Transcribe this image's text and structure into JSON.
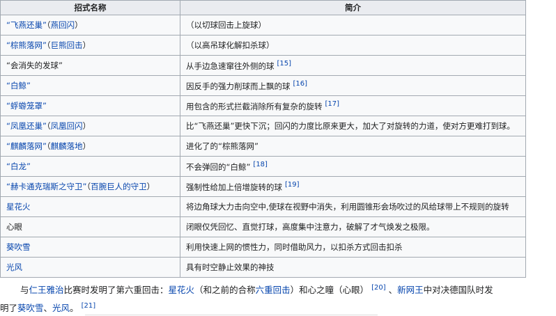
{
  "table": {
    "headers": [
      "招式名称",
      "简介"
    ],
    "rows": [
      {
        "name_link": "“飞燕还巢”",
        "name_tail": "（",
        "alias": "燕回闪",
        "alias_tail": "）",
        "desc": "（以切球回击上旋球）",
        "ref": ""
      },
      {
        "name_link": "“棕熊落网”",
        "name_tail": "（",
        "alias": "巨熊回击",
        "alias_tail": "）",
        "desc": "（以高吊球化解扣杀球）",
        "ref": ""
      },
      {
        "name_plain": "“会消失的发球”",
        "desc": "从手边急速窜往外侧的球",
        "ref": "[15]"
      },
      {
        "name_link": "“白鲸”",
        "desc": "因反手的强力削球而上飘的球",
        "ref": "[16]"
      },
      {
        "name_link": "“蜉蝣笼罩”",
        "desc": "用包含的形式拦截消除所有复杂的旋转",
        "ref": "[17]"
      },
      {
        "name_link": "“凤凰还巢”",
        "name_tail": "（",
        "alias": "凤凰回闪",
        "alias_tail": "）",
        "desc": "比“飞燕还巢”更快下沉；回闪的力度比原来更大，加大了对旋转的力道，使对方更难打到球。",
        "ref": ""
      },
      {
        "name_link": "“麒麟落网”",
        "name_tail": "（",
        "alias": "麒麟落地",
        "alias_tail": "）",
        "desc": "进化了的“棕熊落网”",
        "ref": ""
      },
      {
        "name_link": "“白龙”",
        "desc": "不会弹回的“白鲸”",
        "ref": "[18]"
      },
      {
        "name_link": "“赫卡通克瑞斯之守卫”",
        "name_tail": "（",
        "alias": "百腕巨人的守卫",
        "alias_tail": "）",
        "desc": "强制性给加上倍增旋转的球",
        "ref": "[19]"
      },
      {
        "name_link": "星花火",
        "desc": "将边角球大力击向空中,使球在视野中消失，利用圆锥形会场吹过的风给球带上不规则的旋转",
        "ref": ""
      },
      {
        "name_plain": "心眼",
        "desc": "闭眼仅凭回忆、直觉打球，高度集中注意力，破解了才气焕发之极限。",
        "ref": ""
      },
      {
        "name_link": "葵吹雪",
        "desc": "利用快速上网的惯性力，同时借助风力，以扣杀方式回击扣杀",
        "ref": ""
      },
      {
        "name_link": "光风",
        "desc": "具有时空静止效果的神技",
        "ref": ""
      }
    ]
  },
  "paragraph": {
    "t1": "与",
    "l1": "仁王雅治",
    "t2": "比赛时发明了第六重回击：",
    "l2": "星花火",
    "t3": "（和之前的合称",
    "l3": "六重回击",
    "t4": "）和心之瞳（心眼）",
    "r1": "[20]",
    "t5": "、",
    "l4": "新网王",
    "t6": "中对决德国队时发",
    "t7": "明了",
    "l5": "葵吹雪",
    "t8": "、",
    "l6": "光风",
    "t9": "。",
    "r2": "[21]"
  }
}
